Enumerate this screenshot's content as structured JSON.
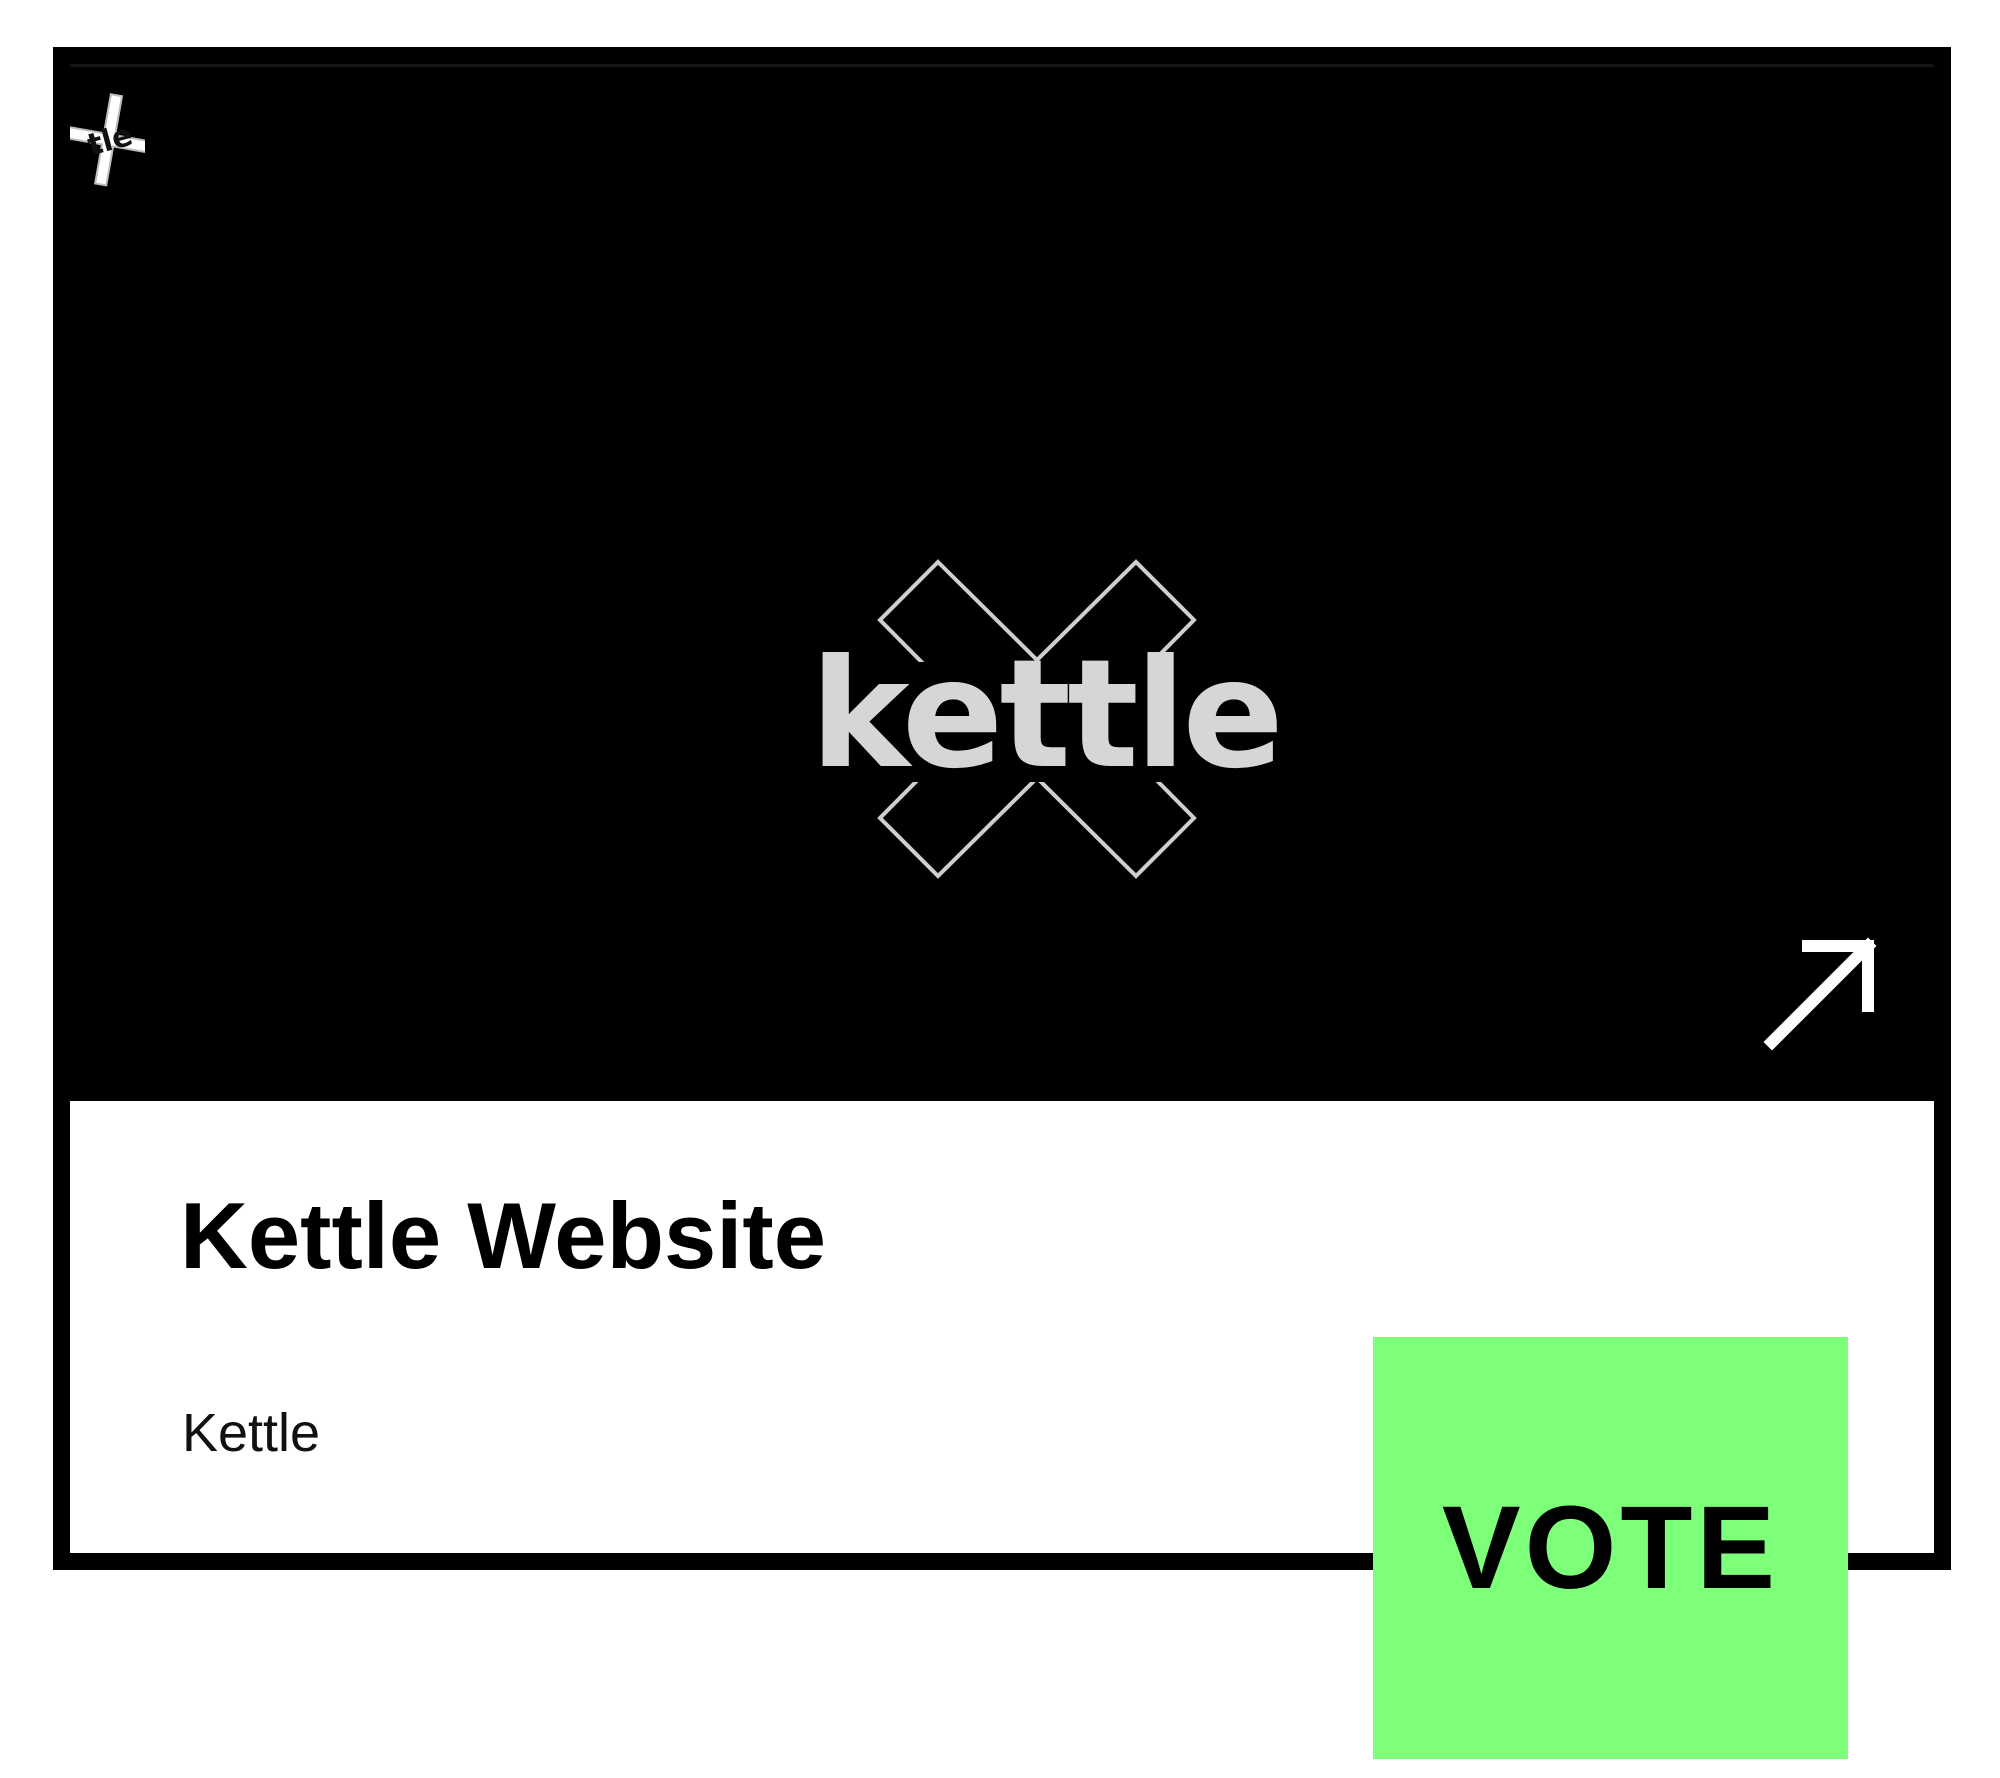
{
  "card": {
    "title": "Kettle Website",
    "author": "Kettle",
    "vote_label": "VOTE",
    "logo_text": "kettle",
    "corner_logo_text": "tle"
  },
  "icons": {
    "open": "arrow-up-right-icon",
    "corner_logo": "kettle-logo",
    "hero_logo": "kettle-logo"
  },
  "colors": {
    "card_frame": "#000000",
    "info_background": "#ffffff",
    "vote_background": "#7dff7a",
    "vote_text": "#000000",
    "logo_fill": "#d6d6d6",
    "arrow": "#ffffff"
  }
}
